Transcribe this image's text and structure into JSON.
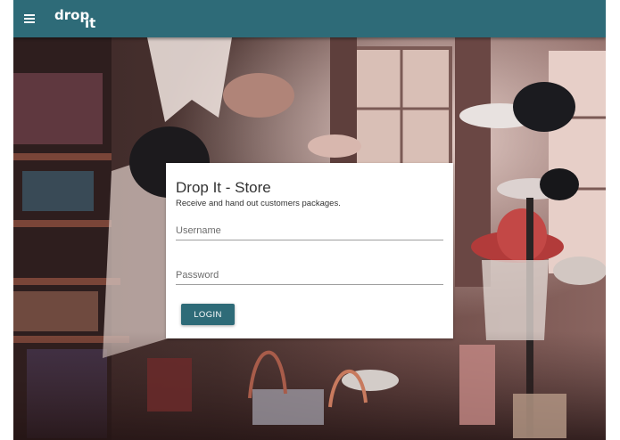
{
  "app": {
    "brand_word_1": "drop",
    "brand_word_2": "it",
    "menu_icon": "hamburger-menu-icon",
    "colors": {
      "appbar": "#2e6b78",
      "button": "#2e6b78",
      "card": "#ffffff"
    }
  },
  "login": {
    "title": "Drop It - Store",
    "subtitle": "Receive and hand out customers packages.",
    "username_placeholder": "Username",
    "username_value": "",
    "password_placeholder": "Password",
    "password_value": "",
    "button_label": "LOGIN"
  },
  "background": {
    "image": "vintage-hat-shop-photo"
  }
}
